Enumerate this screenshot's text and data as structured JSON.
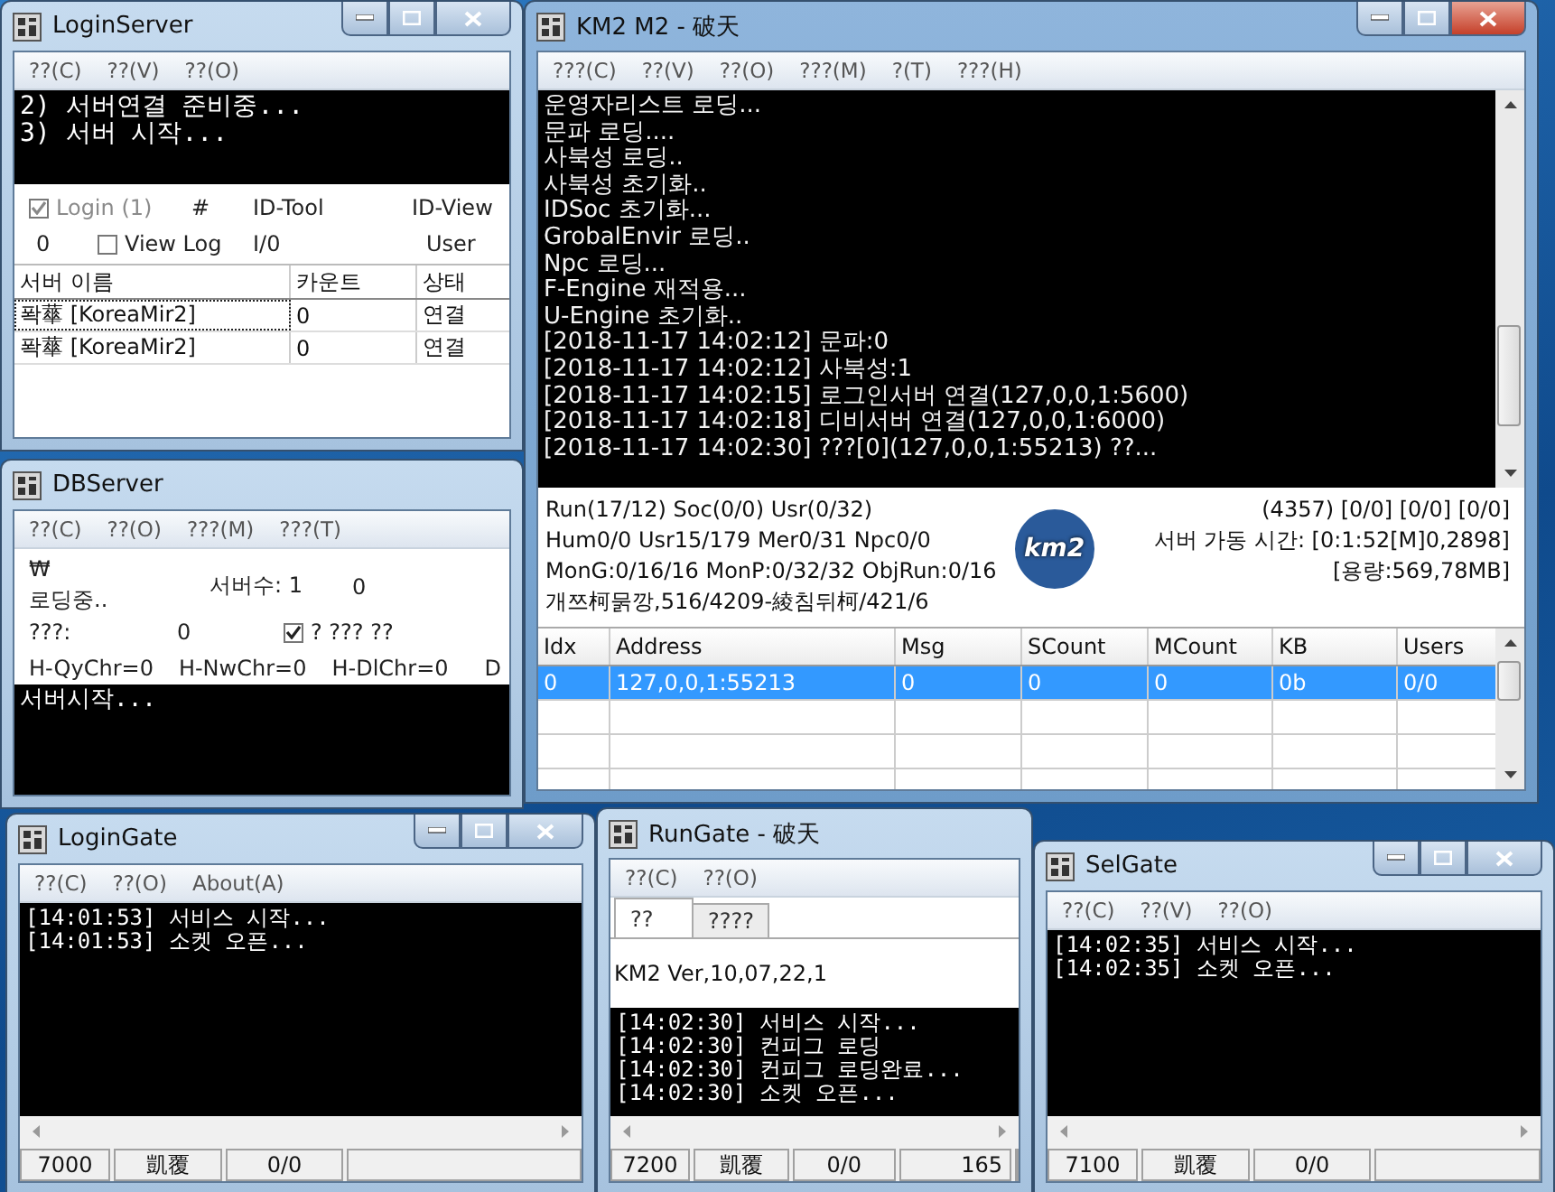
{
  "windows": [
    {
      "kind": "loginserver",
      "title": "LoginServer",
      "caption_buttons": true,
      "active": false,
      "menu": [
        "??(C)",
        "??(V)",
        "??(O)"
      ],
      "log": [
        "2) 서버연결 준비중...",
        "3) 서버 시작..."
      ],
      "login_check": {
        "label": "Login (1)",
        "checked": true,
        "disabled": true
      },
      "hash_label": "#",
      "id_tool": "ID-Tool",
      "id_view": "ID-View",
      "count": "0",
      "viewlog_check": {
        "label": "View Log",
        "checked": false
      },
      "io_label": "I/0",
      "user_label": "User",
      "table": {
        "columns": [
          "서버 이름",
          "카운트",
          "상태"
        ],
        "rows": [
          {
            "cells": [
              "퐉蕐 [KoreaMir2]",
              "0",
              "연결"
            ],
            "focused": true
          },
          {
            "cells": [
              "퐉蕐 [KoreaMir2]",
              "0",
              "연결"
            ],
            "focused": false
          }
        ]
      }
    },
    {
      "kind": "m2",
      "title": "KM2 M2 - 破天",
      "caption_buttons": true,
      "active": true,
      "menu": [
        "???(C)",
        "??(V)",
        "??(O)",
        "???(M)",
        "?(T)",
        "???(H)"
      ],
      "log": [
        "운영자리스트 로딩...",
        "문파 로딩....",
        "사북성 로딩..",
        "사북성 초기화..",
        "IDSoc 초기화...",
        "GrobalEnvir 로딩..",
        "Npc 로딩...",
        "F-Engine 재적용...",
        "U-Engine 초기화..",
        "[2018-11-17 14:02:12] 문파:0",
        "[2018-11-17 14:02:12] 사북성:1",
        "[2018-11-17 14:02:15] 로그인서버 연결(127,0,0,1:5600)",
        "[2018-11-17 14:02:18] 디비서버 연결(127,0,0,1:6000)",
        "[2018-11-17 14:02:30] ???[0](127,0,0,1:55213) ??..."
      ],
      "stats_left": [
        "Run(17/12) Soc(0/0) Usr(0/32)",
        "Hum0/0 Usr15/179 Mer0/31 Npc0/0",
        "MonG:0/16/16 MonP:0/32/32 ObjRun:0/16",
        "개쯔柯묽깡,516/4209-綾침뒤柯/421/6"
      ],
      "logo_text": "km2",
      "stats_right": [
        "(4357) [0/0] [0/0] [0/0]",
        "서버 가동 시간: [0:1:52[M]0,2898]",
        "[용량:569,78MB]"
      ],
      "table": {
        "columns": [
          "Idx",
          "Address",
          "Msg",
          "SCount",
          "MCount",
          "KB",
          "Users"
        ],
        "rows": [
          {
            "cells": [
              "0",
              "127,0,0,1:55213",
              "0",
              "0",
              "0",
              "0b",
              "0/0"
            ],
            "selected": true
          }
        ]
      }
    },
    {
      "kind": "dbserver",
      "title": "DBServer",
      "caption_buttons": false,
      "active": false,
      "menu": [
        "??(C)",
        "??(O)",
        "???(M)",
        "???(T)"
      ],
      "symbol": "₩",
      "loading": "로딩중..",
      "server_count": "서버수: 1",
      "server_count_value": "0",
      "q_label": "???:",
      "q_value": "0",
      "check": {
        "label": "? ??? ??",
        "checked": true
      },
      "counters": [
        "H-QyChr=0",
        "H-NwChr=0",
        "H-DlChr=0",
        "D"
      ],
      "log": [
        "서버시작..."
      ]
    },
    {
      "kind": "gate",
      "title": "LoginGate",
      "caption_buttons": true,
      "active": false,
      "menu": [
        "??(C)",
        "??(O)",
        "About(A)"
      ],
      "log": [
        "[14:01:53] 서비스 시작...",
        "[14:01:53] 소켓 오픈..."
      ],
      "status": [
        "7000",
        "凱覆",
        "0/0"
      ]
    },
    {
      "kind": "gate",
      "title": "RunGate - 破天",
      "caption_buttons": false,
      "active": false,
      "menu": [
        "??(C)",
        "??(O)"
      ],
      "tabs": [
        {
          "label": "??",
          "selected": true
        },
        {
          "label": "????",
          "selected": false
        }
      ],
      "version": "KM2 Ver,10,07,22,1",
      "log": [
        "[14:02:30] 서비스 시작...",
        "[14:02:30] 컨피그 로딩",
        "[14:02:30] 컨피그 로딩완료...",
        "[14:02:30] 소켓 오픈..."
      ],
      "status": [
        "7200",
        "凱覆",
        "0/0",
        "165"
      ]
    },
    {
      "kind": "gate",
      "title": "SelGate",
      "caption_buttons": true,
      "active": false,
      "menu": [
        "??(C)",
        "??(V)",
        "??(O)"
      ],
      "log": [
        "[14:02:35] 서비스 시작...",
        "[14:02:35] 소켓 오픈..."
      ],
      "status": [
        "7100",
        "凱覆",
        "0/0"
      ]
    }
  ]
}
